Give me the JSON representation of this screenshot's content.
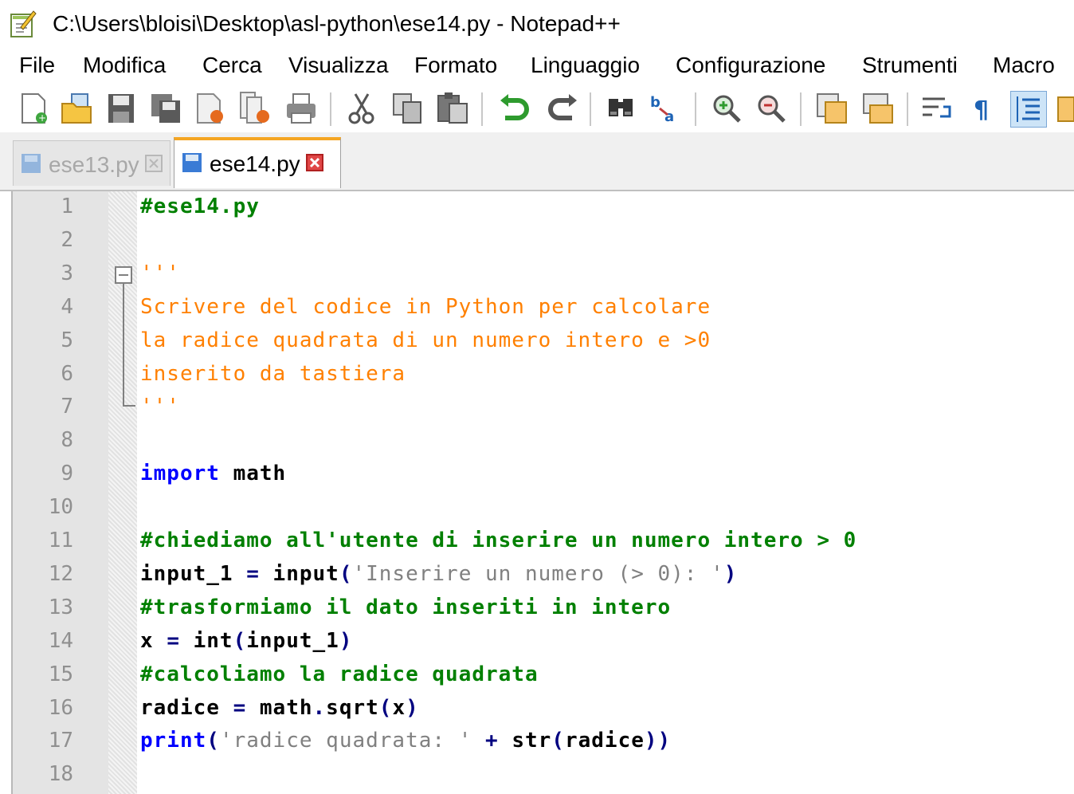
{
  "window": {
    "title": "C:\\Users\\bloisi\\Desktop\\asl-python\\ese14.py - Notepad++"
  },
  "menu": [
    "File",
    "Modifica",
    "Cerca",
    "Visualizza",
    "Formato",
    "Linguaggio",
    "Configurazione",
    "Strumenti",
    "Macro"
  ],
  "toolbar": {
    "icons": [
      "new-file-icon",
      "open-file-icon",
      "save-icon",
      "save-all-icon",
      "close-icon",
      "close-all-icon",
      "print-icon",
      "cut-icon",
      "copy-icon",
      "paste-icon",
      "undo-icon",
      "redo-icon",
      "find-icon",
      "replace-icon",
      "zoom-in-icon",
      "zoom-out-icon",
      "sync-vertical-icon",
      "sync-horizontal-icon",
      "word-wrap-icon",
      "show-all-chars-icon",
      "indent-guide-icon"
    ]
  },
  "tabs": [
    {
      "label": "ese13.py",
      "active": false
    },
    {
      "label": "ese14.py",
      "active": true
    }
  ],
  "editor": {
    "line_numbers": [
      "1",
      "2",
      "3",
      "4",
      "5",
      "6",
      "7",
      "8",
      "9",
      "10",
      "11",
      "12",
      "13",
      "14",
      "15",
      "16",
      "17",
      "18"
    ],
    "lines": [
      [
        {
          "t": "#ese14.py",
          "c": "comment"
        }
      ],
      [],
      [
        {
          "t": "'''",
          "c": "docstr"
        }
      ],
      [
        {
          "t": "Scrivere del codice in Python per calcolare",
          "c": "docstr"
        }
      ],
      [
        {
          "t": "la radice quadrata di un numero intero e >0",
          "c": "docstr"
        }
      ],
      [
        {
          "t": "inserito da tastiera",
          "c": "docstr"
        }
      ],
      [
        {
          "t": "'''",
          "c": "docstr"
        }
      ],
      [],
      [
        {
          "t": "import",
          "c": "keyword"
        },
        {
          "t": " math",
          "c": "default"
        }
      ],
      [],
      [
        {
          "t": "#chiediamo all'utente di inserire un numero intero > 0",
          "c": "comment"
        }
      ],
      [
        {
          "t": "input_1 ",
          "c": "default"
        },
        {
          "t": "=",
          "c": "op"
        },
        {
          "t": " input",
          "c": "default"
        },
        {
          "t": "(",
          "c": "op"
        },
        {
          "t": "'Inserire un numero (> 0): '",
          "c": "string"
        },
        {
          "t": ")",
          "c": "op"
        }
      ],
      [
        {
          "t": "#trasformiamo il dato inseriti in intero",
          "c": "comment"
        }
      ],
      [
        {
          "t": "x ",
          "c": "default"
        },
        {
          "t": "=",
          "c": "op"
        },
        {
          "t": " int",
          "c": "default"
        },
        {
          "t": "(",
          "c": "op"
        },
        {
          "t": "input_1",
          "c": "default"
        },
        {
          "t": ")",
          "c": "op"
        }
      ],
      [
        {
          "t": "#calcoliamo la radice quadrata",
          "c": "comment"
        }
      ],
      [
        {
          "t": "radice ",
          "c": "default"
        },
        {
          "t": "=",
          "c": "op"
        },
        {
          "t": " math",
          "c": "default"
        },
        {
          "t": ".",
          "c": "op"
        },
        {
          "t": "sqrt",
          "c": "default"
        },
        {
          "t": "(",
          "c": "op"
        },
        {
          "t": "x",
          "c": "default"
        },
        {
          "t": ")",
          "c": "op"
        }
      ],
      [
        {
          "t": "print",
          "c": "keyword"
        },
        {
          "t": "(",
          "c": "op"
        },
        {
          "t": "'radice quadrata: '",
          "c": "string"
        },
        {
          "t": " + ",
          "c": "op"
        },
        {
          "t": "str",
          "c": "default"
        },
        {
          "t": "(",
          "c": "op"
        },
        {
          "t": "radice",
          "c": "default"
        },
        {
          "t": "))",
          "c": "op"
        }
      ],
      []
    ]
  }
}
